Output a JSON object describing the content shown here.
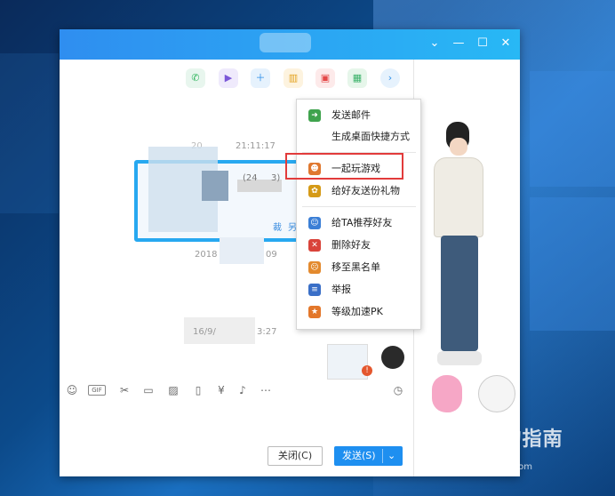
{
  "chat": {
    "timestamps": [
      "21:11:17",
      "2018",
      "09",
      "3:27"
    ],
    "blurred_fragments": [
      "(24",
      "3)",
      "裁",
      "另",
      "16/9/"
    ]
  },
  "context_menu": {
    "items": [
      {
        "label": "发送邮件",
        "icon": "mail-send-icon",
        "color": "#3fa34d"
      },
      {
        "label": "生成桌面快捷方式",
        "icon": "",
        "color": ""
      },
      {
        "label": "一起玩游戏",
        "icon": "game-icon",
        "color": "#e0782f"
      },
      {
        "label": "给好友送份礼物",
        "icon": "gift-icon",
        "color": "#d59a17"
      },
      {
        "label": "给TA推荐好友",
        "icon": "recommend-icon",
        "color": "#3b7fd6"
      },
      {
        "label": "删除好友",
        "icon": "delete-friend-icon",
        "color": "#d9433a"
      },
      {
        "label": "移至黑名单",
        "icon": "blacklist-icon",
        "color": "#e38a2e"
      },
      {
        "label": "举报",
        "icon": "report-icon",
        "color": "#3a6fc7"
      },
      {
        "label": "等级加速PK",
        "icon": "level-pk-icon",
        "color": "#e3772a"
      }
    ]
  },
  "buttons": {
    "close": "关闭(C)",
    "send": "发送(S)"
  },
  "watermark": {
    "main": "搜狗指南",
    "sub": "zhinan.sogou.com"
  },
  "colors": {
    "titlebar_start": "#2f8ef0",
    "titlebar_end": "#28b8f5",
    "send_button": "#1e8ff0",
    "highlight": "#e23b3b"
  }
}
